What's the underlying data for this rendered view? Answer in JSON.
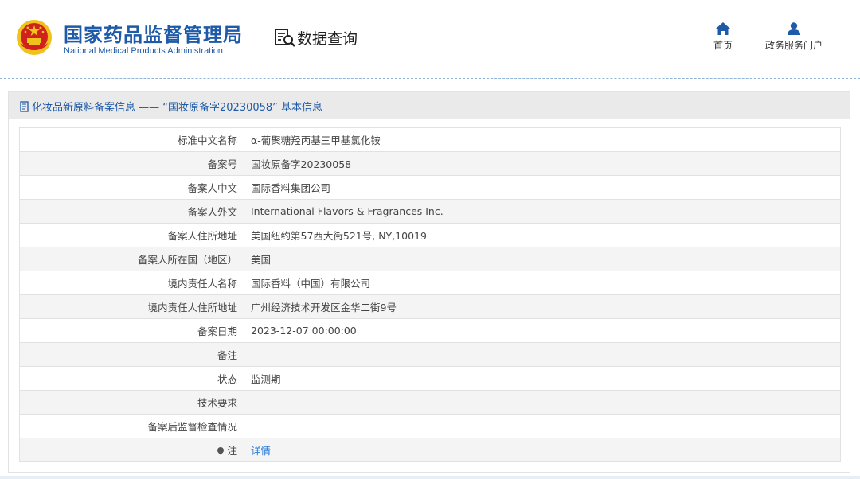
{
  "header": {
    "org_cn": "国家药品监督管理局",
    "org_en": "National Medical Products Administration",
    "query_label": "数据查询",
    "nav": [
      {
        "label": "首页",
        "icon": "home-icon"
      },
      {
        "label": "政务服务门户",
        "icon": "user-icon"
      }
    ]
  },
  "panel": {
    "title": "化妆品新原料备案信息 —— “国妆原备字20230058” 基本信息"
  },
  "table": {
    "rows": [
      {
        "label": "标准中文名称",
        "value": "α-葡聚糖羟丙基三甲基氯化铵"
      },
      {
        "label": "备案号",
        "value": "国妆原备字20230058"
      },
      {
        "label": "备案人中文",
        "value": "国际香料集团公司"
      },
      {
        "label": "备案人外文",
        "value": "International Flavors & Fragrances Inc."
      },
      {
        "label": "备案人住所地址",
        "value": "美国纽约第57西大街521号, NY,10019"
      },
      {
        "label": "备案人所在国（地区）",
        "value": "美国"
      },
      {
        "label": "境内责任人名称",
        "value": "国际香料（中国）有限公司"
      },
      {
        "label": "境内责任人住所地址",
        "value": "广州经济技术开发区金华二街9号"
      },
      {
        "label": "备案日期",
        "value": "2023-12-07 00:00:00"
      },
      {
        "label": "备注",
        "value": ""
      },
      {
        "label": "状态",
        "value": "监测期"
      },
      {
        "label": "技术要求",
        "value": ""
      },
      {
        "label": "备案后监督检查情况",
        "value": ""
      },
      {
        "label": "注",
        "value": "详情"
      }
    ]
  },
  "colors": {
    "brand_blue": "#1e5aa8",
    "link_blue": "#2b7bd9",
    "emblem_red": "#d0221c",
    "emblem_gold": "#f1c21b"
  }
}
